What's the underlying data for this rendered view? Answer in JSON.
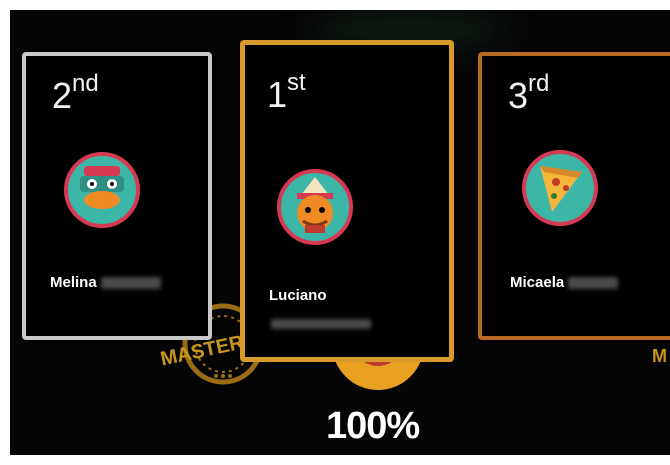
{
  "podium": {
    "first": {
      "rank_num": "1",
      "rank_suffix": "st",
      "name": "Luciano",
      "avatar_icon": "cat-with-hat-avatar-icon"
    },
    "second": {
      "rank_num": "2",
      "rank_suffix": "nd",
      "name": "Melina",
      "avatar_icon": "platypus-avatar-icon"
    },
    "third": {
      "rank_num": "3",
      "rank_suffix": "rd",
      "name": "Micaela",
      "avatar_icon": "pizza-slice-avatar-icon"
    }
  },
  "badges": {
    "left": "MASTER",
    "right": "M"
  },
  "score": {
    "percent_label": "100%"
  },
  "colors": {
    "gold": "#d89a2a",
    "silver": "#c9c9c9",
    "bronze": "#b86a22",
    "avatar_ring": "#d63a52",
    "avatar_fill": "#3cb6a6"
  }
}
